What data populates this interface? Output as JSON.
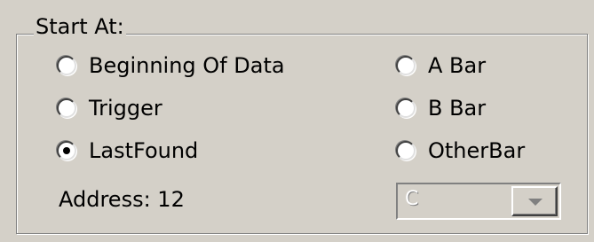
{
  "group": {
    "title": "Start At:",
    "options": [
      {
        "id": "beginning",
        "label": "Beginning Of Data",
        "checked": false
      },
      {
        "id": "trigger",
        "label": "Trigger",
        "checked": false
      },
      {
        "id": "lastfound",
        "label": "LastFound",
        "checked": true
      },
      {
        "id": "abar",
        "label": "A Bar",
        "checked": false
      },
      {
        "id": "bbar",
        "label": "B Bar",
        "checked": false
      },
      {
        "id": "otherbar",
        "label": "OtherBar",
        "checked": false
      }
    ],
    "address_label": "Address: 12",
    "otherbar_select": {
      "value": "C",
      "disabled": true
    }
  }
}
